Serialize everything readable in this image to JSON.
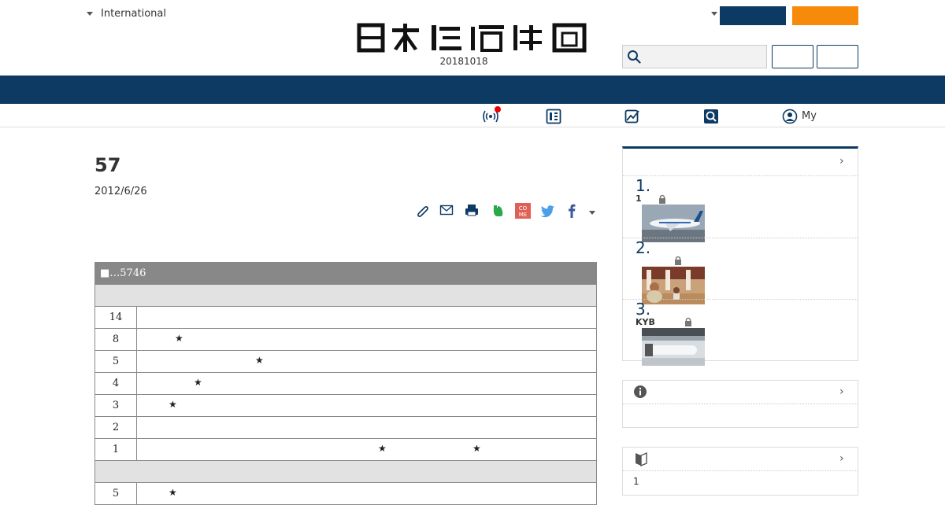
{
  "header": {
    "edition_label": "International",
    "date_code": "20181018",
    "brand_color": "#0d3a63",
    "accent_color": "#f7890b"
  },
  "subnav": {
    "icons": [
      "broadcast-icon",
      "newspaper-icon",
      "chart-icon",
      "search-icon",
      "user-icon"
    ],
    "my_label": "My"
  },
  "article": {
    "title": "57",
    "date": "2012/6/26",
    "share_icons": [
      "clip-icon",
      "mail-icon",
      "print-icon",
      "evernote-icon",
      "comment-icon",
      "twitter-icon",
      "facebook-icon"
    ]
  },
  "table": {
    "header": "■…5746",
    "rows": [
      {
        "num": "14",
        "stars": []
      },
      {
        "num": "8",
        "stars": [
          48
        ]
      },
      {
        "num": "5",
        "stars": [
          150
        ]
      },
      {
        "num": "4",
        "stars": [
          72
        ]
      },
      {
        "num": "3",
        "stars": [
          40
        ]
      },
      {
        "num": "2",
        "stars": []
      },
      {
        "num": "1",
        "stars": [
          306,
          426
        ]
      }
    ],
    "rows2": [
      {
        "num": "5",
        "stars": [
          40
        ]
      }
    ],
    "star_glyph": "★"
  },
  "ranking": {
    "items": [
      {
        "num": "1.",
        "label": "1"
      },
      {
        "num": "2.",
        "label": ""
      },
      {
        "num": "3.",
        "label": "KYB"
      }
    ]
  },
  "sidebar": {
    "box3_count": "1"
  }
}
